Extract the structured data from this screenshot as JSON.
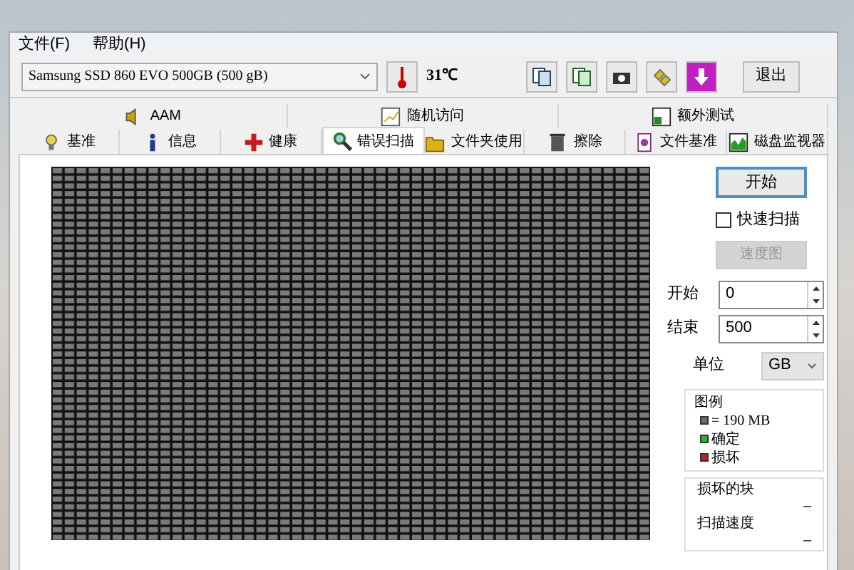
{
  "menu": [
    {
      "label": "文件(F)"
    },
    {
      "label": "帮助(H)"
    }
  ],
  "toolbar": {
    "drive": "Samsung SSD 860 EVO 500GB (500 gB)",
    "temperature": "31℃",
    "exit": "退出"
  },
  "tabs_top": [
    {
      "label": "AAM",
      "selected": false
    },
    {
      "label": "随机访问",
      "selected": false
    },
    {
      "label": "额外测试",
      "selected": false
    }
  ],
  "tabs": [
    {
      "label": "基准",
      "selected": false
    },
    {
      "label": "信息",
      "selected": false
    },
    {
      "label": "健康",
      "selected": false
    },
    {
      "label": "错误扫描",
      "selected": true
    },
    {
      "label": "文件夹使用",
      "selected": false
    },
    {
      "label": "擦除",
      "selected": false
    },
    {
      "label": "文件基准",
      "selected": false
    },
    {
      "label": "磁盘监视器",
      "selected": false
    }
  ],
  "scan": {
    "start_button": "开始",
    "quick_scan": {
      "label": "快速扫描",
      "checked": false
    },
    "speed_map": {
      "label": "速度图",
      "disabled": true
    },
    "start": {
      "label": "开始",
      "value": "0"
    },
    "end": {
      "label": "结束",
      "value": "500"
    },
    "unit": {
      "label": "单位",
      "value": "GB"
    }
  },
  "legend": {
    "title": "图例",
    "items": [
      {
        "label": "= 190 MB",
        "color": "#6e6e6e"
      },
      {
        "label": "确定",
        "color": "#22bb33"
      },
      {
        "label": "损坏",
        "color": "#bb2222"
      }
    ]
  },
  "stats": [
    {
      "label": "损坏的块",
      "value": "–"
    },
    {
      "label": "扫描速度",
      "value": "–"
    }
  ]
}
